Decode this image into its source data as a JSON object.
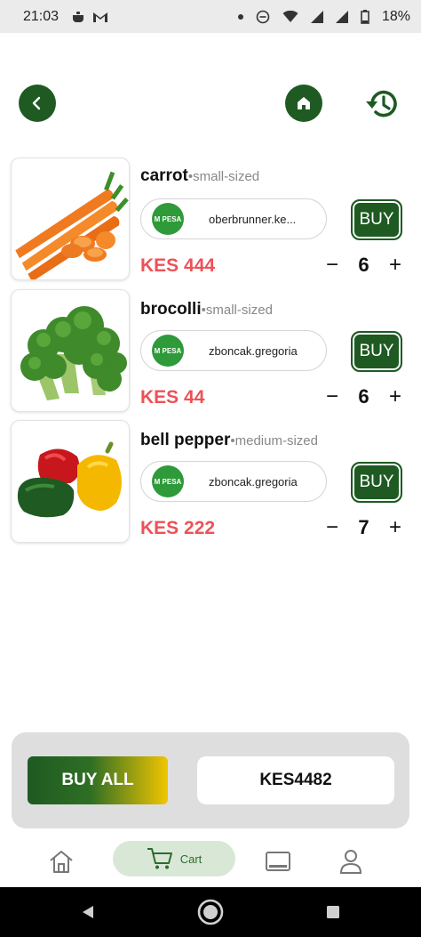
{
  "status_bar": {
    "time": "21:03",
    "battery": "18%"
  },
  "products": [
    {
      "name": "carrot",
      "size": "small-sized",
      "payment_account": "oberbrunner.ke...",
      "buy_label": "BUY",
      "price": "KES 444",
      "quantity": "6",
      "image_icon": "carrot-image"
    },
    {
      "name": "brocolli",
      "size": "small-sized",
      "payment_account": "zboncak.gregoria",
      "buy_label": "BUY",
      "price": "KES 44",
      "quantity": "6",
      "image_icon": "broccoli-image"
    },
    {
      "name": "bell pepper",
      "size": "medium-sized",
      "payment_account": "zboncak.gregoria",
      "buy_label": "BUY",
      "price": "KES 222",
      "quantity": "7",
      "image_icon": "bell-pepper-image"
    }
  ],
  "payment_logo_text": "M PESA",
  "summary": {
    "buy_all_label": "BUY ALL",
    "total": "KES4482"
  },
  "bottom_nav": {
    "cart_label": "Cart"
  },
  "colors": {
    "brand_green": "#1e5a22",
    "price_red": "#ec5257",
    "mpesa_green": "#2e9a39",
    "gradient_yellow": "#f2c500",
    "cart_tab_bg": "#d9e8d6"
  },
  "qty_symbols": {
    "minus": "−",
    "plus": "+"
  },
  "dot": "•"
}
